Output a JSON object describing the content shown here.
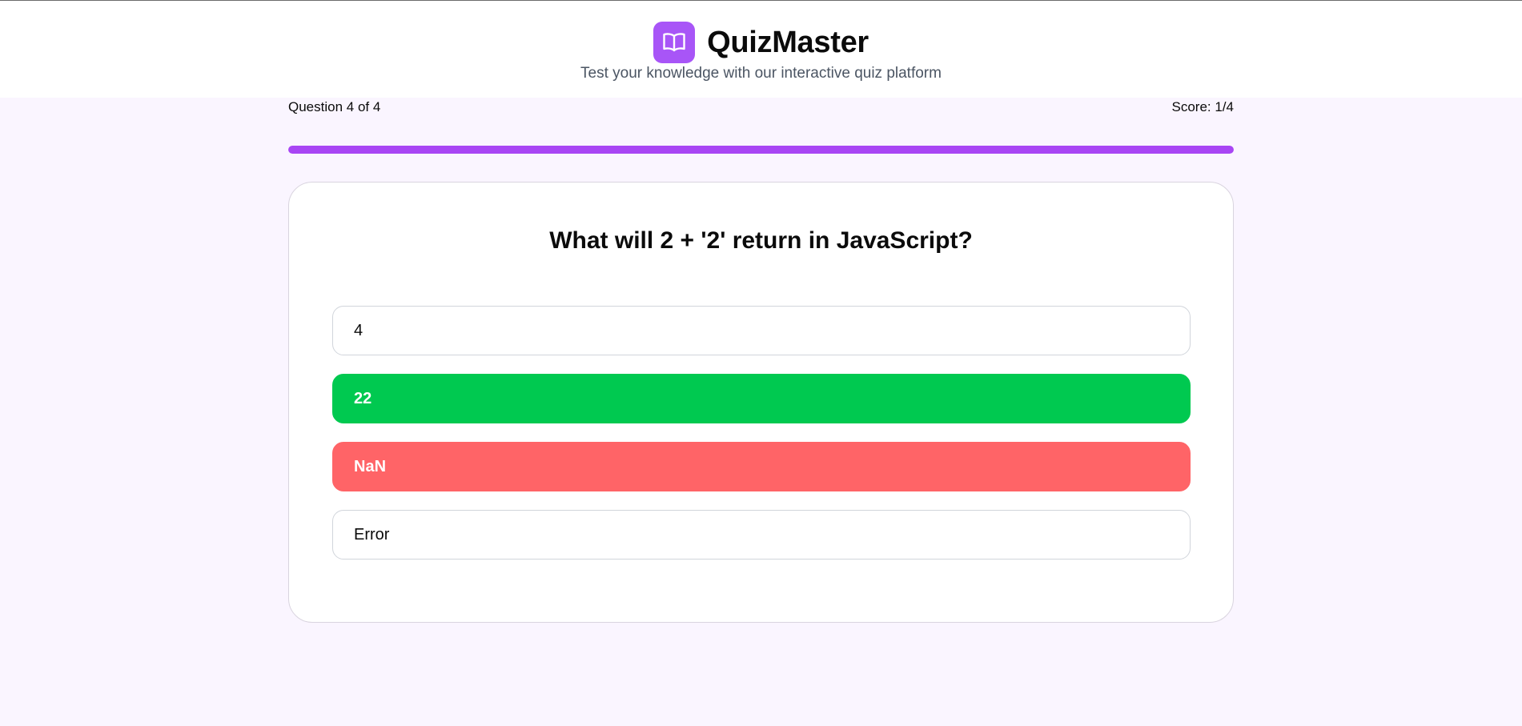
{
  "header": {
    "logo_icon": "open-book-icon",
    "title": "QuizMaster",
    "subtitle": "Test your knowledge with our interactive quiz platform"
  },
  "progress": {
    "question_label": "Question 4 of 4",
    "score_label": "Score: 1/4",
    "fraction": 1.0
  },
  "question": {
    "text": "What will 2 + '2' return in JavaScript?",
    "options": [
      {
        "label": "4",
        "state": "default"
      },
      {
        "label": "22",
        "state": "correct"
      },
      {
        "label": "NaN",
        "state": "wrong"
      },
      {
        "label": "Error",
        "state": "default"
      }
    ]
  },
  "colors": {
    "accent": "#a855f7",
    "correct": "#00c950",
    "wrong": "#ff6467",
    "background": "#faf5ff"
  }
}
